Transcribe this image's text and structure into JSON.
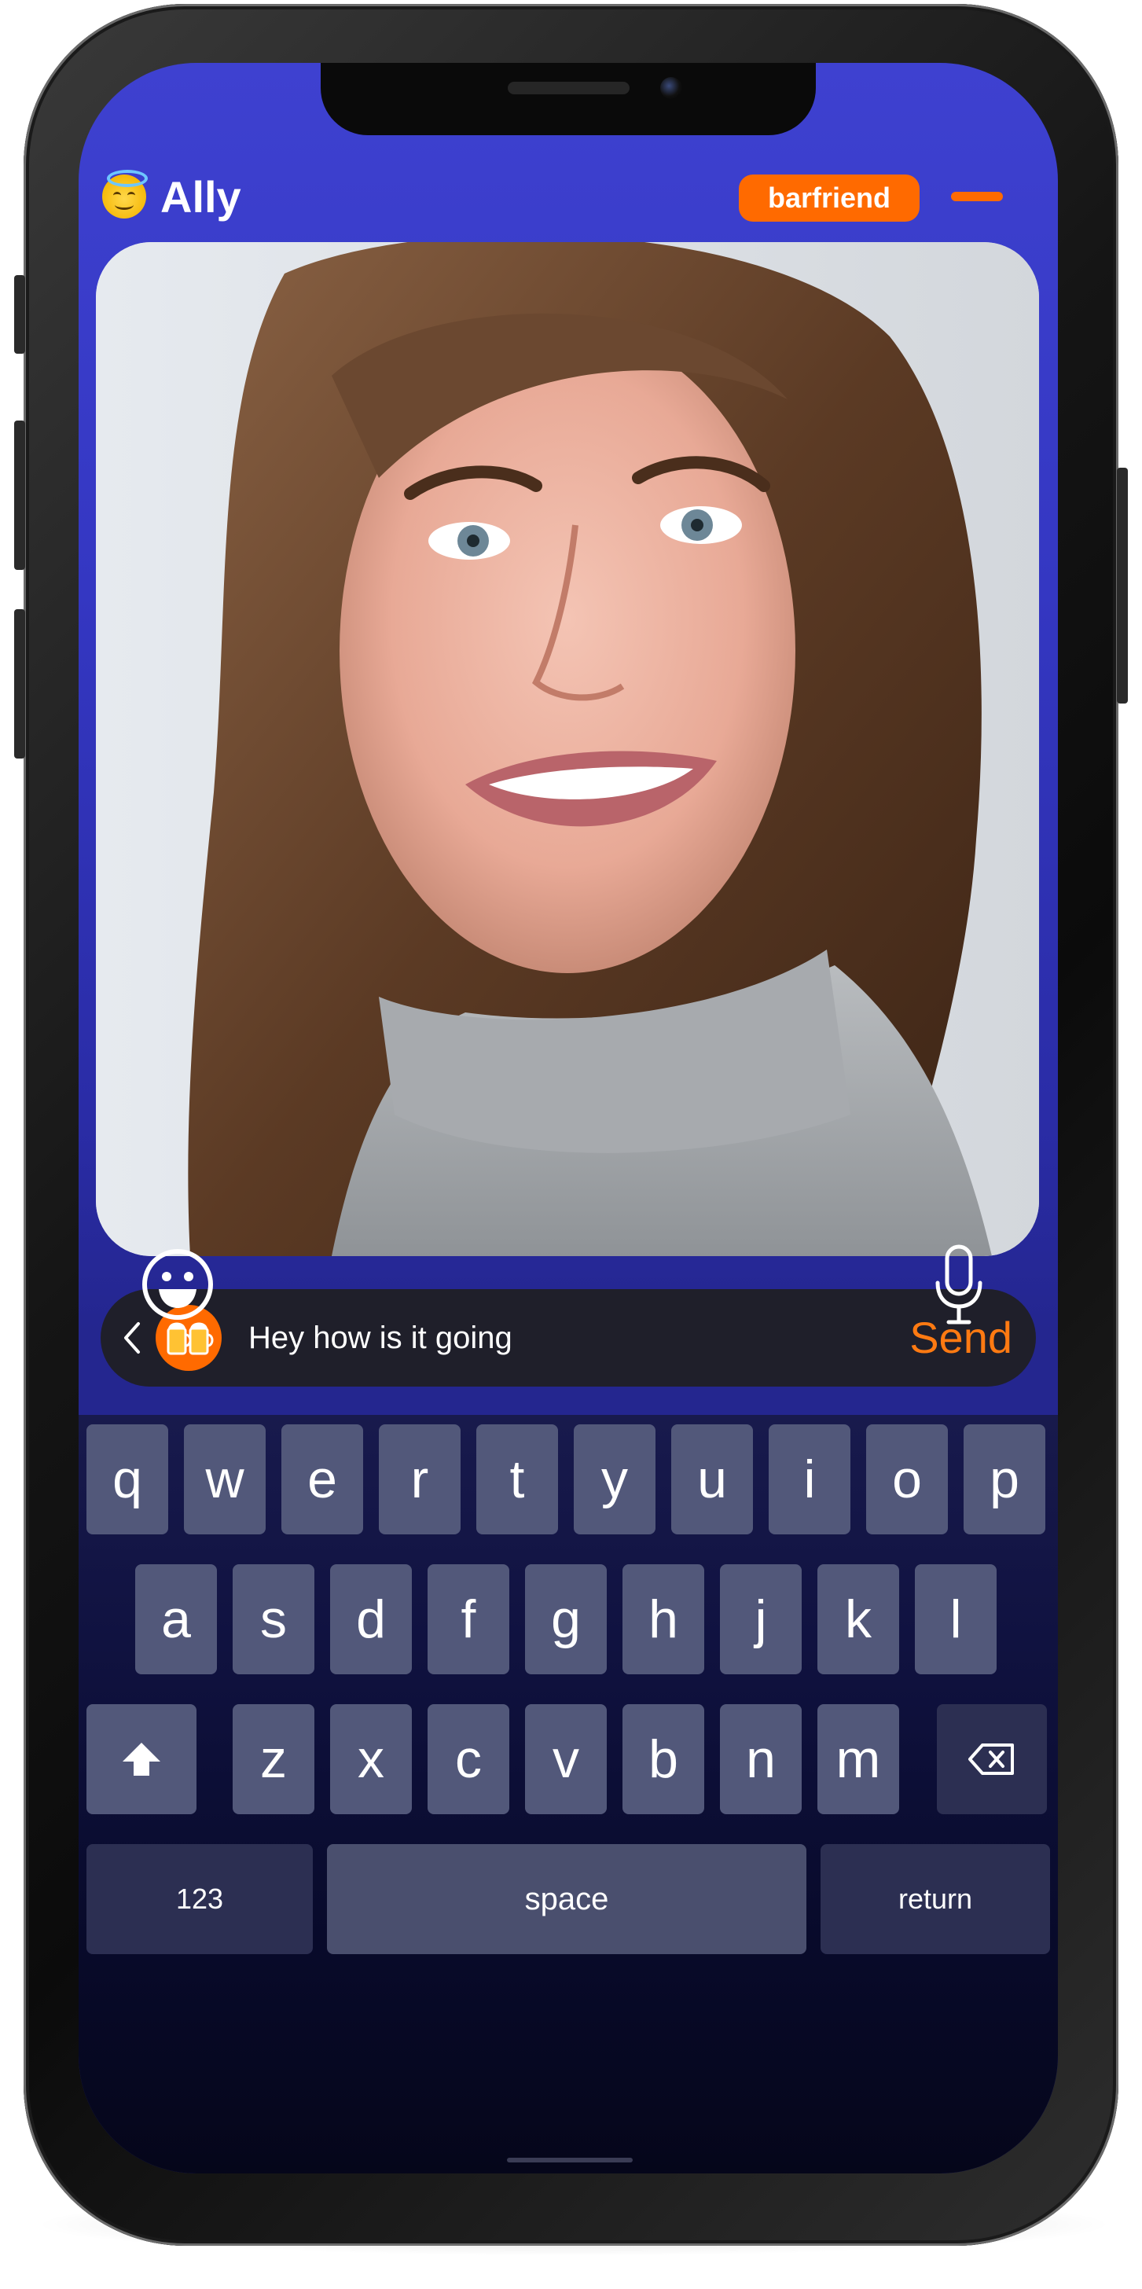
{
  "header": {
    "app_name": "Ally",
    "mode_label": "barfriend",
    "halo_icon": "smiling-face-with-halo-icon",
    "menu_icon": "menu-bar-icon"
  },
  "photo": {
    "subject": "portrait"
  },
  "composer": {
    "back_icon": "chevron-left-icon",
    "avatar_icon": "beer-mugs-icon",
    "input_value": "Hey how is it going",
    "send_label": "Send"
  },
  "keyboard": {
    "row1": [
      "q",
      "w",
      "e",
      "r",
      "t",
      "y",
      "u",
      "i",
      "o",
      "p"
    ],
    "row2": [
      "a",
      "s",
      "d",
      "f",
      "g",
      "h",
      "j",
      "k",
      "l"
    ],
    "row3": [
      "z",
      "x",
      "c",
      "v",
      "b",
      "n",
      "m"
    ],
    "numbers_label": "123",
    "space_label": "space",
    "return_label": "return",
    "shift_icon": "shift-arrow-icon",
    "delete_icon": "backspace-icon",
    "emoji_icon": "emoji-face-icon",
    "mic_icon": "microphone-icon"
  },
  "colors": {
    "accent": "#ff6a00",
    "screen_top": "#3e41d0",
    "keyboard_bg": "#0a0c30",
    "key_bg": "#52587a"
  }
}
